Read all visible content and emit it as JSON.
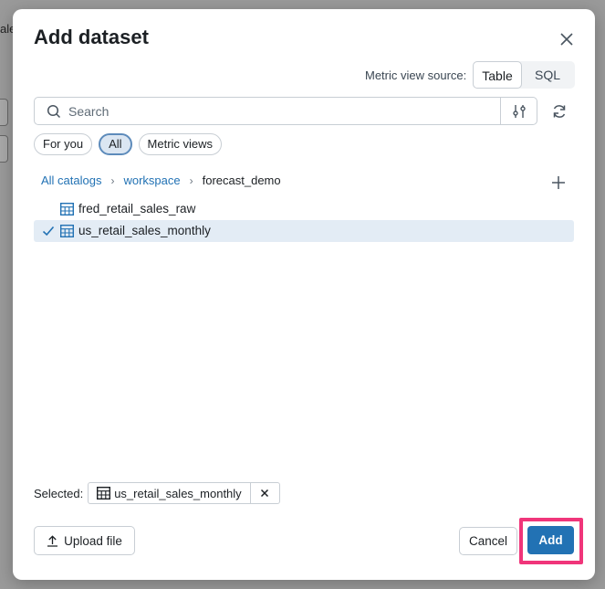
{
  "background": {
    "fragment": "ale"
  },
  "dialog": {
    "title": "Add dataset",
    "metric_view_source": {
      "label": "Metric view source:",
      "options": [
        "Table",
        "SQL"
      ],
      "selected": "Table"
    },
    "search": {
      "placeholder": "Search",
      "value": ""
    },
    "filter_chips": [
      {
        "label": "For you",
        "active": false
      },
      {
        "label": "All",
        "active": true
      },
      {
        "label": "Metric views",
        "active": false
      }
    ],
    "breadcrumb": {
      "items": [
        "All catalogs",
        "workspace",
        "forecast_demo"
      ]
    },
    "tables": [
      {
        "name": "fred_retail_sales_raw",
        "selected": false,
        "icon": "table-icon"
      },
      {
        "name": "us_retail_sales_monthly",
        "selected": true,
        "icon": "table-icon"
      }
    ],
    "selection": {
      "label": "Selected:",
      "items": [
        "us_retail_sales_monthly"
      ]
    },
    "buttons": {
      "upload": "Upload file",
      "cancel": "Cancel",
      "add": "Add"
    },
    "colors": {
      "accent": "#2272b4",
      "highlight": "#f0357a",
      "selected_row": "#e3ecf5"
    }
  }
}
